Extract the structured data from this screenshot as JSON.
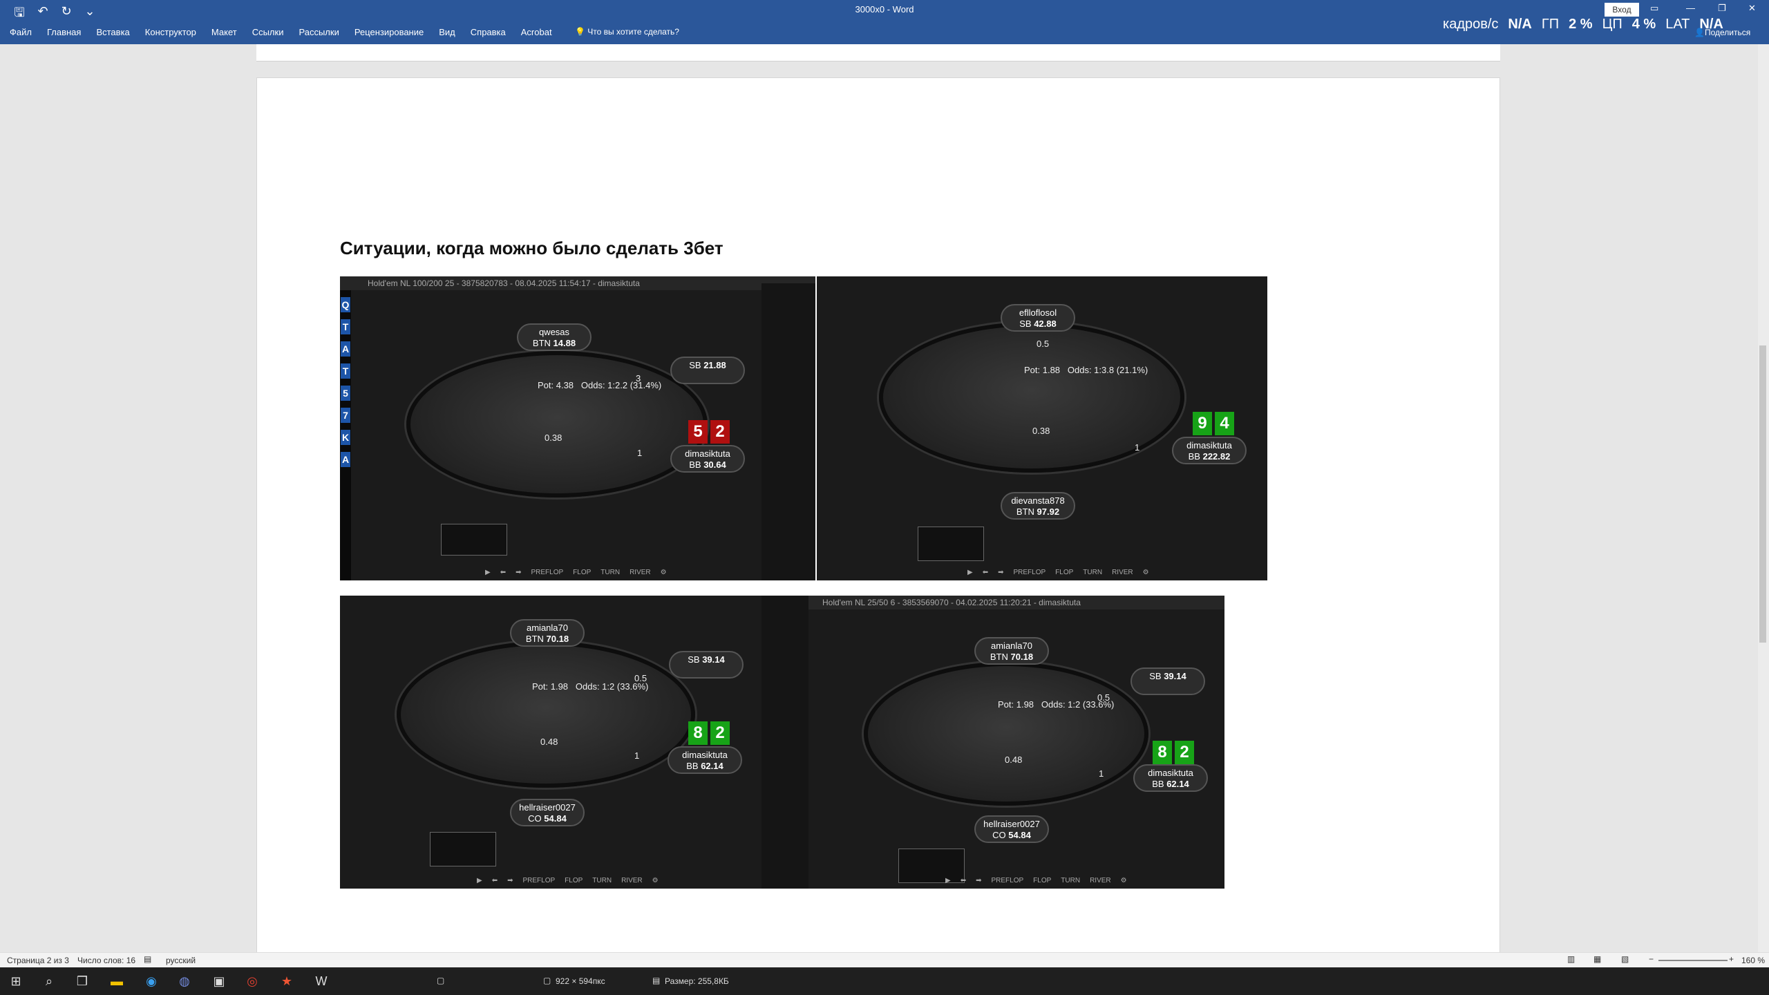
{
  "window": {
    "title": "3000x0 - Word",
    "signin": "Вход"
  },
  "ribbon": {
    "menu": [
      "Файл",
      "Главная",
      "Вставка",
      "Конструктор",
      "Макет",
      "Ссылки",
      "Рассылки",
      "Рецензирование",
      "Вид",
      "Справка",
      "Acrobat"
    ],
    "tell_me": "Что вы хотите сделать?",
    "share": "Поделиться"
  },
  "overlay": {
    "frames_label": "кадров/с",
    "frames_value": "N/A",
    "gpu_label": "ГП",
    "gpu_value": "2 %",
    "cpu_label": "ЦП",
    "cpu_value": "4 %",
    "lat_label": "LAT",
    "lat_value": "N/A"
  },
  "document": {
    "heading": "Ситуации, когда можно было сделать 3бет"
  },
  "shots": [
    {
      "header": "Hold'em NL 100/200 25 - 3875820783 - 08.04.2025 11:54:17 - dimasiktuta",
      "pot": "Pot: 4.38",
      "odds": "Odds: 1:2.2 (31.4%)",
      "cards": [
        "5",
        "2"
      ],
      "card_color": "#b01010",
      "hero": {
        "name": "dimasiktuta",
        "pos": "BB",
        "stack": "30.64"
      },
      "villain1": {
        "name": "qwesas",
        "pos": "BTN",
        "stack": "14.88"
      },
      "villain2": {
        "name": "",
        "pos": "SB",
        "stack": "21.88"
      },
      "chip1": "0.38",
      "chip2": "1",
      "chip3": "3",
      "left_letters": [
        "Q",
        "T",
        "A",
        "T",
        "5",
        "7",
        "K",
        "A"
      ]
    },
    {
      "header": "",
      "pot": "Pot: 1.88",
      "odds": "Odds: 1:3.8 (21.1%)",
      "cards": [
        "9",
        "4"
      ],
      "card_color": "#17a317",
      "hero": {
        "name": "dimasiktuta",
        "pos": "BB",
        "stack": "222.82"
      },
      "villain1": {
        "name": "eflloflosol",
        "pos": "SB",
        "stack": "42.88"
      },
      "villain2": {
        "name": "dievansta878",
        "pos": "BTN",
        "stack": "97.92"
      },
      "chip1": "0.38",
      "chip2": "1",
      "chip3": "0.5"
    },
    {
      "header": "",
      "pot": "Pot: 1.98",
      "odds": "Odds: 1:2 (33.6%)",
      "cards": [
        "8",
        "2"
      ],
      "card_color": "#17a317",
      "hero": {
        "name": "dimasiktuta",
        "pos": "BB",
        "stack": "62.14"
      },
      "villain1": {
        "name": "amianla70",
        "pos": "BTN",
        "stack": "70.18"
      },
      "villain2": {
        "name": "hellraiser0027",
        "pos": "CO",
        "stack": "54.84"
      },
      "villain3": {
        "name": "",
        "pos": "SB",
        "stack": "39.14"
      },
      "chip1": "0.48",
      "chip2": "1",
      "chip3": "0.5"
    },
    {
      "header": "Hold'em NL 25/50 6 - 3853569070 - 04.02.2025 11:20:21 - dimasiktuta",
      "pot": "Pot: 1.98",
      "odds": "Odds: 1:2 (33.6%)",
      "cards": [
        "8",
        "2"
      ],
      "card_color": "#17a317",
      "hero": {
        "name": "dimasiktuta",
        "pos": "BB",
        "stack": "62.14"
      },
      "villain1": {
        "name": "amianla70",
        "pos": "BTN",
        "stack": "70.18"
      },
      "villain2": {
        "name": "hellraiser0027",
        "pos": "CO",
        "stack": "54.84"
      },
      "villain3": {
        "name": "",
        "pos": "SB",
        "stack": "39.14"
      },
      "chip1": "0.48",
      "chip2": "1",
      "chip3": "0.5"
    }
  ],
  "replay_controls": [
    "PREFLOP",
    "FLOP",
    "TURN",
    "RIVER"
  ],
  "statusbar": {
    "page": "Страница 2 из 3",
    "words": "Число слов: 16",
    "language": "русский",
    "zoom": "160 %"
  },
  "taskbar": {
    "dimensions": "922 × 594пкс",
    "size": "Размер: 255,8КБ"
  }
}
